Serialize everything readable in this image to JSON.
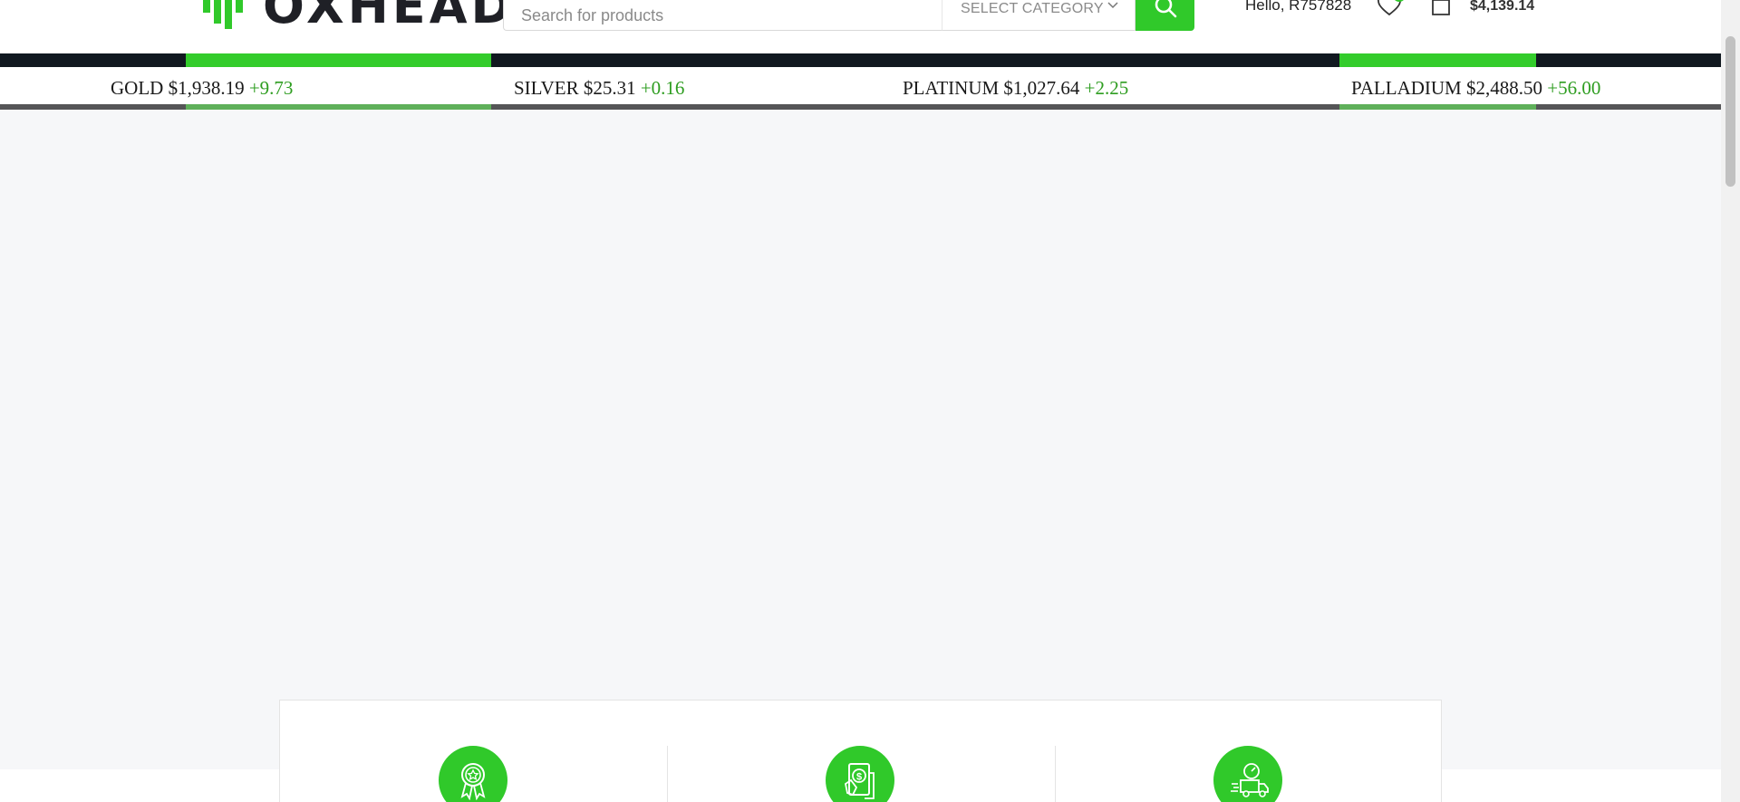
{
  "header": {
    "logo_text": "OXHEAD",
    "search": {
      "placeholder": "Search for products"
    },
    "category_label": "SELECT CATEGORY",
    "greeting": "Hello, R757828",
    "cart_total": "$4,139.14"
  },
  "ticker": {
    "items": [
      {
        "name": "GOLD",
        "price": "$1,938.19",
        "change": "+9.73"
      },
      {
        "name": "SILVER",
        "price": "$25.31",
        "change": "+0.16"
      },
      {
        "name": "PLATINUM",
        "price": "$1,027.64",
        "change": "+2.25"
      },
      {
        "name": "PALLADIUM",
        "price": "$2,488.50",
        "change": "+56.00"
      }
    ]
  },
  "features": {
    "icons": [
      "award-ribbon-icon",
      "cash-payment-icon",
      "fast-delivery-truck-icon"
    ]
  },
  "colors": {
    "accent": "#30c92a",
    "dark_bar": "#111820",
    "page_background": "#f6f7f9"
  }
}
